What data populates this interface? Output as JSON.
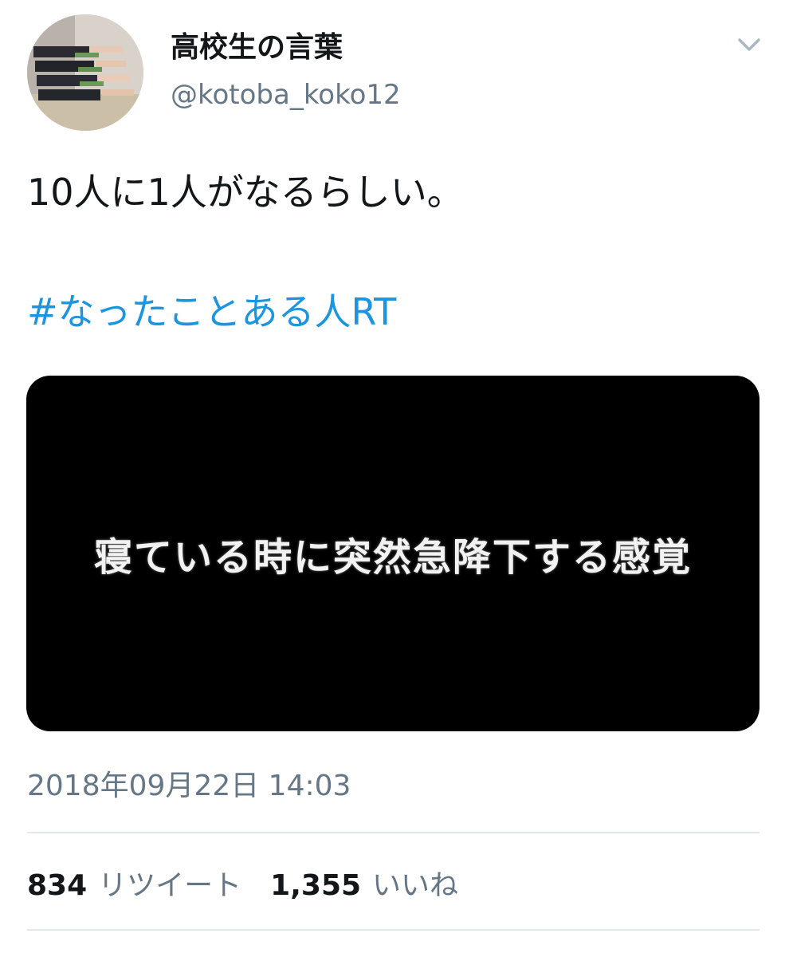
{
  "user": {
    "display_name": "高校生の言葉",
    "handle": "@kotoba_koko12",
    "avatar_icon": "profile-photo"
  },
  "menu": {
    "icon": "chevron-down-icon"
  },
  "tweet": {
    "text": "10人に1人がなるらしい。",
    "hashtag": "#なったことある人RT",
    "media_caption": "寝ている時に突然急降下する感覚",
    "timestamp": "2018年09月22日 14:03"
  },
  "stats": {
    "retweets_count": "834",
    "retweets_label": "リツイート",
    "likes_count": "1,355",
    "likes_label": "いいね"
  },
  "colors": {
    "text": "#14171a",
    "secondary": "#657786",
    "link": "#1b95e0",
    "divider": "#e1e8ed",
    "media_background": "#000000"
  }
}
